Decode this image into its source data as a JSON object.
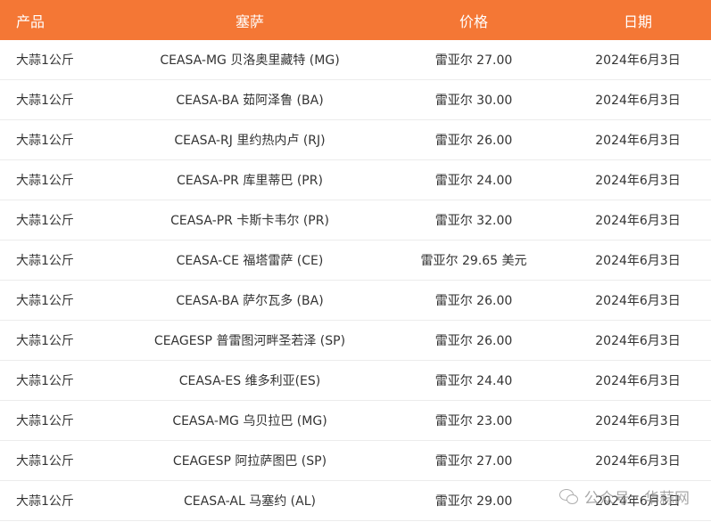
{
  "table": {
    "headers": {
      "product": "产品",
      "ceasa": "塞萨",
      "price": "价格",
      "date": "日期"
    },
    "rows": [
      {
        "product": "大蒜1公斤",
        "ceasa": "CEASA-MG 贝洛奥里藏特 (MG)",
        "price": "雷亚尔 27.00",
        "date": "2024年6月3日"
      },
      {
        "product": "大蒜1公斤",
        "ceasa": "CEASA-BA 茹阿泽鲁 (BA)",
        "price": "雷亚尔 30.00",
        "date": "2024年6月3日"
      },
      {
        "product": "大蒜1公斤",
        "ceasa": "CEASA-RJ 里约热内卢 (RJ)",
        "price": "雷亚尔 26.00",
        "date": "2024年6月3日"
      },
      {
        "product": "大蒜1公斤",
        "ceasa": "CEASA-PR 库里蒂巴 (PR)",
        "price": "雷亚尔 24.00",
        "date": "2024年6月3日"
      },
      {
        "product": "大蒜1公斤",
        "ceasa": "CEASA-PR 卡斯卡韦尔 (PR)",
        "price": "雷亚尔 32.00",
        "date": "2024年6月3日"
      },
      {
        "product": "大蒜1公斤",
        "ceasa": "CEASA-CE 福塔雷萨 (CE)",
        "price": "雷亚尔 29.65 美元",
        "date": "2024年6月3日"
      },
      {
        "product": "大蒜1公斤",
        "ceasa": "CEASA-BA 萨尔瓦多 (BA)",
        "price": "雷亚尔 26.00",
        "date": "2024年6月3日"
      },
      {
        "product": "大蒜1公斤",
        "ceasa": "CEAGESP 普雷图河畔圣若泽 (SP)",
        "price": "雷亚尔 26.00",
        "date": "2024年6月3日"
      },
      {
        "product": "大蒜1公斤",
        "ceasa": "CEASA-ES 维多利亚(ES)",
        "price": "雷亚尔 24.40",
        "date": "2024年6月3日"
      },
      {
        "product": "大蒜1公斤",
        "ceasa": "CEASA-MG 乌贝拉巴 (MG)",
        "price": "雷亚尔 23.00",
        "date": "2024年6月3日"
      },
      {
        "product": "大蒜1公斤",
        "ceasa": "CEAGESP 阿拉萨图巴 (SP)",
        "price": "雷亚尔 27.00",
        "date": "2024年6月3日"
      },
      {
        "product": "大蒜1公斤",
        "ceasa": "CEASA-AL 马塞约 (AL)",
        "price": "雷亚尔 29.00",
        "date": "2024年6月3日"
      }
    ]
  },
  "colors": {
    "header_bg": "#f47735",
    "header_text": "#ffffff",
    "row_border": "#ececec"
  },
  "watermark": {
    "icon": "wechat-icon",
    "text": "公众号 · 华蒜网"
  }
}
